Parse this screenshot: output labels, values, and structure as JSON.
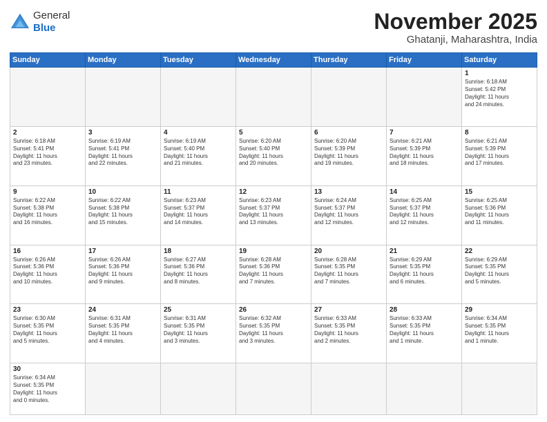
{
  "header": {
    "logo_general": "General",
    "logo_blue": "Blue",
    "month": "November 2025",
    "location": "Ghatanji, Maharashtra, India"
  },
  "weekdays": [
    "Sunday",
    "Monday",
    "Tuesday",
    "Wednesday",
    "Thursday",
    "Friday",
    "Saturday"
  ],
  "weeks": [
    [
      {
        "day": "",
        "info": ""
      },
      {
        "day": "",
        "info": ""
      },
      {
        "day": "",
        "info": ""
      },
      {
        "day": "",
        "info": ""
      },
      {
        "day": "",
        "info": ""
      },
      {
        "day": "",
        "info": ""
      },
      {
        "day": "1",
        "info": "Sunrise: 6:18 AM\nSunset: 5:42 PM\nDaylight: 11 hours\nand 24 minutes."
      }
    ],
    [
      {
        "day": "2",
        "info": "Sunrise: 6:18 AM\nSunset: 5:41 PM\nDaylight: 11 hours\nand 23 minutes."
      },
      {
        "day": "3",
        "info": "Sunrise: 6:19 AM\nSunset: 5:41 PM\nDaylight: 11 hours\nand 22 minutes."
      },
      {
        "day": "4",
        "info": "Sunrise: 6:19 AM\nSunset: 5:40 PM\nDaylight: 11 hours\nand 21 minutes."
      },
      {
        "day": "5",
        "info": "Sunrise: 6:20 AM\nSunset: 5:40 PM\nDaylight: 11 hours\nand 20 minutes."
      },
      {
        "day": "6",
        "info": "Sunrise: 6:20 AM\nSunset: 5:39 PM\nDaylight: 11 hours\nand 19 minutes."
      },
      {
        "day": "7",
        "info": "Sunrise: 6:21 AM\nSunset: 5:39 PM\nDaylight: 11 hours\nand 18 minutes."
      },
      {
        "day": "8",
        "info": "Sunrise: 6:21 AM\nSunset: 5:39 PM\nDaylight: 11 hours\nand 17 minutes."
      }
    ],
    [
      {
        "day": "9",
        "info": "Sunrise: 6:22 AM\nSunset: 5:38 PM\nDaylight: 11 hours\nand 16 minutes."
      },
      {
        "day": "10",
        "info": "Sunrise: 6:22 AM\nSunset: 5:38 PM\nDaylight: 11 hours\nand 15 minutes."
      },
      {
        "day": "11",
        "info": "Sunrise: 6:23 AM\nSunset: 5:37 PM\nDaylight: 11 hours\nand 14 minutes."
      },
      {
        "day": "12",
        "info": "Sunrise: 6:23 AM\nSunset: 5:37 PM\nDaylight: 11 hours\nand 13 minutes."
      },
      {
        "day": "13",
        "info": "Sunrise: 6:24 AM\nSunset: 5:37 PM\nDaylight: 11 hours\nand 12 minutes."
      },
      {
        "day": "14",
        "info": "Sunrise: 6:25 AM\nSunset: 5:37 PM\nDaylight: 11 hours\nand 12 minutes."
      },
      {
        "day": "15",
        "info": "Sunrise: 6:25 AM\nSunset: 5:36 PM\nDaylight: 11 hours\nand 11 minutes."
      }
    ],
    [
      {
        "day": "16",
        "info": "Sunrise: 6:26 AM\nSunset: 5:36 PM\nDaylight: 11 hours\nand 10 minutes."
      },
      {
        "day": "17",
        "info": "Sunrise: 6:26 AM\nSunset: 5:36 PM\nDaylight: 11 hours\nand 9 minutes."
      },
      {
        "day": "18",
        "info": "Sunrise: 6:27 AM\nSunset: 5:36 PM\nDaylight: 11 hours\nand 8 minutes."
      },
      {
        "day": "19",
        "info": "Sunrise: 6:28 AM\nSunset: 5:36 PM\nDaylight: 11 hours\nand 7 minutes."
      },
      {
        "day": "20",
        "info": "Sunrise: 6:28 AM\nSunset: 5:35 PM\nDaylight: 11 hours\nand 7 minutes."
      },
      {
        "day": "21",
        "info": "Sunrise: 6:29 AM\nSunset: 5:35 PM\nDaylight: 11 hours\nand 6 minutes."
      },
      {
        "day": "22",
        "info": "Sunrise: 6:29 AM\nSunset: 5:35 PM\nDaylight: 11 hours\nand 5 minutes."
      }
    ],
    [
      {
        "day": "23",
        "info": "Sunrise: 6:30 AM\nSunset: 5:35 PM\nDaylight: 11 hours\nand 5 minutes."
      },
      {
        "day": "24",
        "info": "Sunrise: 6:31 AM\nSunset: 5:35 PM\nDaylight: 11 hours\nand 4 minutes."
      },
      {
        "day": "25",
        "info": "Sunrise: 6:31 AM\nSunset: 5:35 PM\nDaylight: 11 hours\nand 3 minutes."
      },
      {
        "day": "26",
        "info": "Sunrise: 6:32 AM\nSunset: 5:35 PM\nDaylight: 11 hours\nand 3 minutes."
      },
      {
        "day": "27",
        "info": "Sunrise: 6:33 AM\nSunset: 5:35 PM\nDaylight: 11 hours\nand 2 minutes."
      },
      {
        "day": "28",
        "info": "Sunrise: 6:33 AM\nSunset: 5:35 PM\nDaylight: 11 hours\nand 1 minute."
      },
      {
        "day": "29",
        "info": "Sunrise: 6:34 AM\nSunset: 5:35 PM\nDaylight: 11 hours\nand 1 minute."
      }
    ],
    [
      {
        "day": "30",
        "info": "Sunrise: 6:34 AM\nSunset: 5:35 PM\nDaylight: 11 hours\nand 0 minutes."
      },
      {
        "day": "",
        "info": ""
      },
      {
        "day": "",
        "info": ""
      },
      {
        "day": "",
        "info": ""
      },
      {
        "day": "",
        "info": ""
      },
      {
        "day": "",
        "info": ""
      },
      {
        "day": "",
        "info": ""
      }
    ]
  ]
}
